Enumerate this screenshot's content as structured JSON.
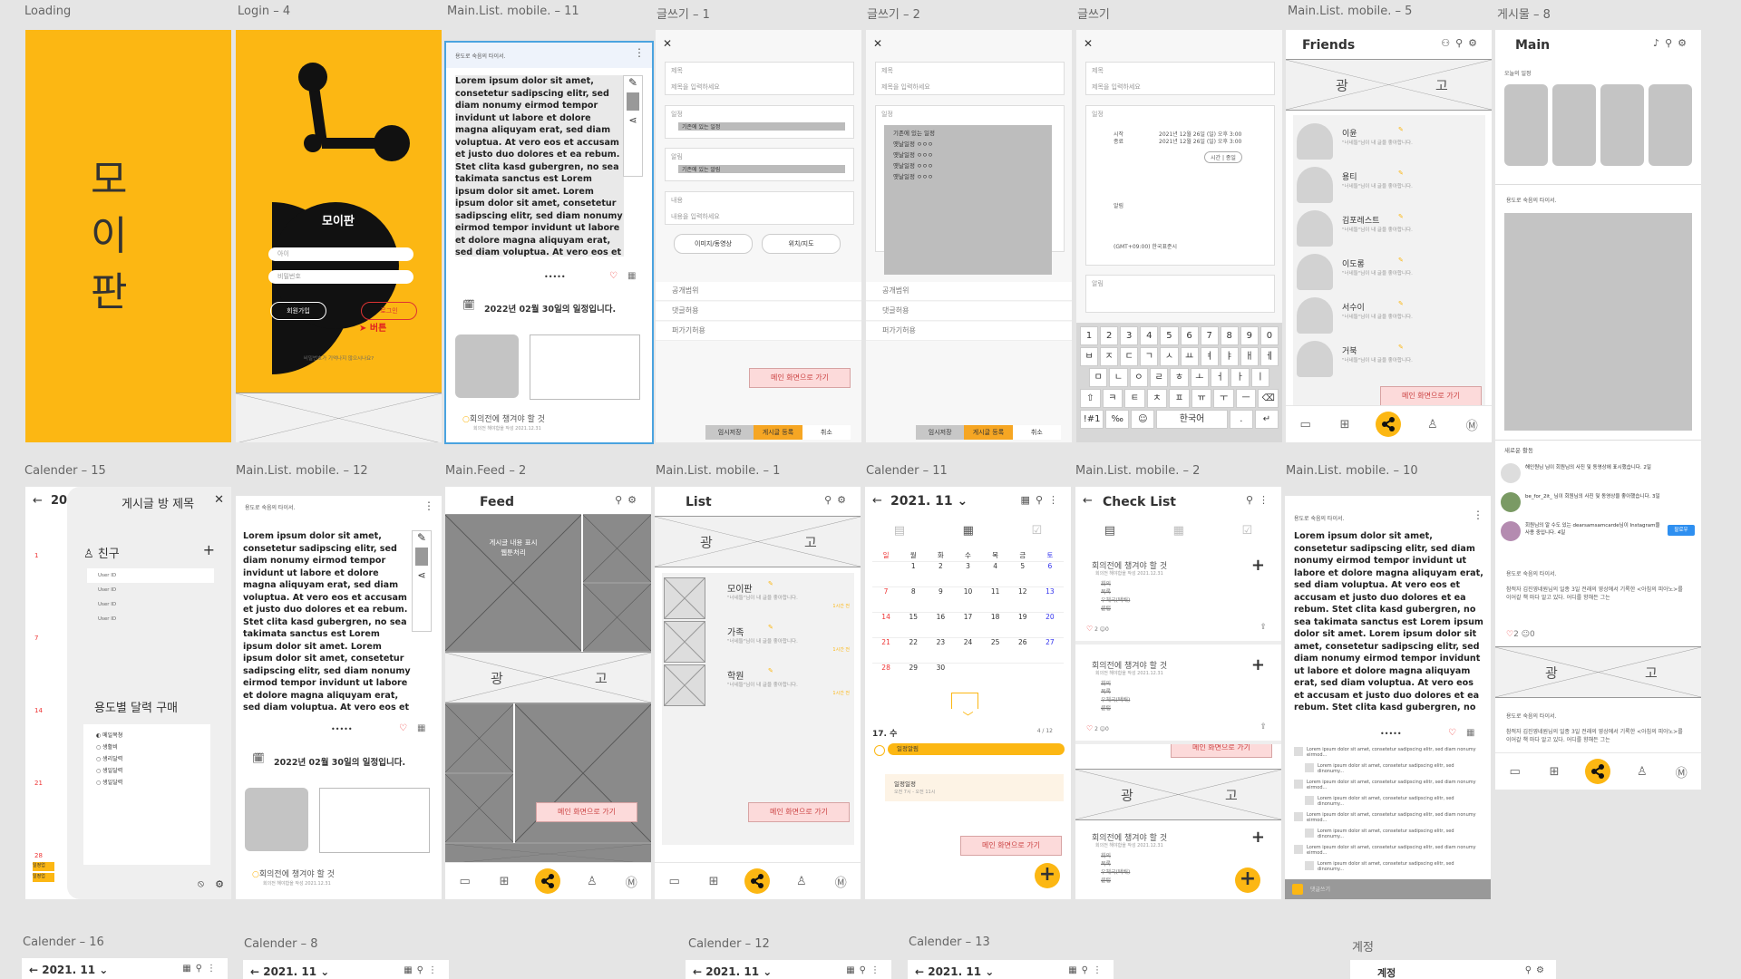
{
  "labels": {
    "loading": "Loading",
    "login4": "Login – 4",
    "mainlist11": "Main.List. mobile. – 11",
    "write1": "글쓰기 – 1",
    "write2": "글쓰기 – 2",
    "write": "글쓰기",
    "mainlist5": "Main.List. mobile. – 5",
    "post8": "게시물 – 8",
    "cal15": "Calender – 15",
    "mainlist12": "Main.List. mobile. – 12",
    "feed2": "Main.Feed – 2",
    "mainlist1": "Main.List. mobile. – 1",
    "cal11": "Calender – 11",
    "mainlist2": "Main.List. mobile. – 2",
    "mainlist10": "Main.List. mobile. – 10",
    "cal16": "Calender – 16",
    "cal8": "Calender – 8",
    "cal12": "Calender – 12",
    "cal13": "Calender – 13",
    "account": "계정"
  },
  "loading": {
    "c1": "모",
    "c2": "이",
    "c3": "판"
  },
  "login": {
    "app_name": "모이판",
    "id_placeholder": "아이",
    "pw_placeholder": "비밀번호",
    "signup": "회원가입",
    "login": "로그인",
    "button_annot": "버튼",
    "forgot": "비밀번호가 기억나지 않으시나요?"
  },
  "lorem": "Lorem ipsum dolor sit amet, consetetur sadipscing elitr, sed diam nonumy eirmod tempor invidunt ut labore et dolore magna aliquyam erat, sed diam voluptua. At vero eos et accusam et justo duo dolores et ea rebum. Stet clita kasd gubergren, no sea takimata sanctus est Lorem ipsum dolor sit amet. Lorem ipsum dolor sit amet, consetetur sadipscing elitr, sed diam nonumy eirmod tempor invidunt ut labore et dolore magna aliquyam erat, sed diam voluptua. At vero eos et accusam et justo duo dolores et ea rebum. Stet clita kasd gubergren, no sea takimata sanctus est Lorem ipsum dolor sit amet. Lorem ipsum dolor sit amet, consetetur",
  "post": {
    "header": "용도로 숙음의 타이서.",
    "schedule": "2022년 02월 30일의 일정입니다.",
    "todo": "회의전에 챙겨야 할 것",
    "todo_sub": "회의전 해야합을 작성 2021.12.31"
  },
  "write": {
    "title": "제목",
    "title_ph": "제목을 입력하세요",
    "schedule": "일정",
    "schedule_opt": "기존에 있는 일정",
    "alarm": "알림",
    "alarm_opt": "기존에 있는 알림",
    "content": "내용",
    "content_ph": "내용을 입력하세요",
    "image_btn": "이미지/동영상",
    "map_btn": "위치/지도",
    "public": "공개범위",
    "comment": "댓글허용",
    "share": "퍼가기허용",
    "go_main": "메인 화면으로 가기",
    "draft": "임시저장",
    "post": "게시글 등록",
    "cancel": "취소",
    "dropdown": [
      "기존에 있는 일정",
      "옛날일정 ㅇㅇㅇ",
      "옛날일정 ㅇㅇㅇ",
      "옛날일정 ㅇㅇㅇ",
      "옛날일정 ㅇㅇㅇ"
    ],
    "start": "시작",
    "end": "종료",
    "start_val": "2021년 12월 26일 (일) 오후 3:00",
    "end_val": "2021년 12월 26일 (일) 오후 3:00",
    "time_btn": "시간 | 종일",
    "tz": "(GMT+09:00) 한국표준시"
  },
  "keyboard": {
    "nums": [
      "1",
      "2",
      "3",
      "4",
      "5",
      "6",
      "7",
      "8",
      "9",
      "0"
    ],
    "r1": [
      "ㅂ",
      "ㅈ",
      "ㄷ",
      "ㄱ",
      "ㅅ",
      "ㅛ",
      "ㅕ",
      "ㅑ",
      "ㅐ",
      "ㅔ"
    ],
    "r2": [
      "ㅁ",
      "ㄴ",
      "ㅇ",
      "ㄹ",
      "ㅎ",
      "ㅗ",
      "ㅓ",
      "ㅏ",
      "ㅣ"
    ],
    "r3": [
      "⇧",
      "ㅋ",
      "ㅌ",
      "ㅊ",
      "ㅍ",
      "ㅠ",
      "ㅜ",
      "ㅡ",
      "⌫"
    ],
    "r4": [
      "!#1",
      "‰",
      "☺",
      "한국어",
      ".",
      "↵"
    ]
  },
  "friends": {
    "title": "Friends",
    "ad_left": "광",
    "ad_right": "고",
    "names": [
      "이윤",
      "용티",
      "김포레스트",
      "이도롱",
      "서수이",
      "거북"
    ],
    "status": "\"너네들\"님이 내 글을 좋아합니다.",
    "go_main": "메인 화면으로 가기"
  },
  "main8": {
    "title": "Main",
    "today": "오늘의 일정",
    "recent": "새로운 활동",
    "act1": "해인원님 님이 회원님의 사진 및 동영상에 표시했습니다. 2일",
    "act2": "be_for_2it_ 님이 회원님의 사진 및 동영상을 좋아했습니다. 3일",
    "act3": "회원님의 알 수도 있는 dearsamsamcarde님이 Instagram을 사용 중입니다. 4일",
    "follow": "팔로우",
    "caption": "참적자 김진영네원님의 일종 3일 전래의 영상에서 기록한 <아침의 피아노>를 이어갈 책 마다 알고 있다. 어디를 향해든 그는"
  },
  "cal15": {
    "year": "20",
    "panel_title": "게시글 방 제목",
    "friends": "친구",
    "users": [
      "User ID",
      "User ID",
      "User ID",
      "User ID"
    ],
    "buy": "용도별 달력 구매",
    "items": [
      "메일목쳥",
      "생활비",
      "생리달력",
      "생일달력",
      "생일달력"
    ],
    "day_a": "1",
    "day_b": "7",
    "day_c": "14",
    "day_d": "21",
    "day_e": "28",
    "tag1": "일정업",
    "tag2": "일정업"
  },
  "feed": {
    "title": "Feed",
    "overlay": "게시글 내용 표시\n웹툰처리",
    "ad_left": "광",
    "ad_right": "고",
    "go_main": "메인 화면으로 가기"
  },
  "list": {
    "title": "List",
    "ad_left": "광",
    "ad_right": "고",
    "items": [
      "모이판",
      "가족",
      "학원"
    ],
    "status": "\"너네들\"님이 내 글을 좋아합니다.",
    "time": "1시간 전",
    "go_main": "메인 화면으로 가기"
  },
  "cal11": {
    "month": "2021. 11",
    "weekdays": [
      "일",
      "월",
      "화",
      "수",
      "목",
      "금",
      "토"
    ],
    "days": [
      "",
      "1",
      "2",
      "3",
      "4",
      "5",
      "6",
      "7",
      "8",
      "9",
      "10",
      "11",
      "12",
      "13",
      "14",
      "15",
      "16",
      "17",
      "18",
      "19",
      "20",
      "21",
      "22",
      "23",
      "24",
      "25",
      "26",
      "27",
      "28",
      "29",
      "30",
      "",
      "",
      "",
      ""
    ],
    "sel_date": "17. 수",
    "count": "4 / 12",
    "event": "일정알림",
    "event2": "일정일정",
    "event2_sub": "오전 7시 - 오전 11시",
    "go_main": "메인 화면으로 가기"
  },
  "checklist": {
    "title": "Check List",
    "card_title": "회의전에 챙겨야 할 것",
    "card_sub": "회의전 해야합을 작성 2021.12.31",
    "items": [
      "회의",
      "목록",
      "우체국(택배)",
      "클럽"
    ],
    "likes": "2",
    "comments": "0",
    "ad_left": "광",
    "ad_right": "고",
    "go_main": "메인 화면으로 가기"
  },
  "ml10": {
    "header": "용도로 숙음의 타이서.",
    "comment_line1": "Lorem ipsum dolor sit amet, consetetur sadipscing elitr, sed diam nonumy eirmod...",
    "comment_line2": "Lorem ipsum dolor sit amet, consetetur sadipscing elitr, sed dinonumy...",
    "input_ph": "댓글쓰기"
  },
  "bottom": {
    "month": "2021. 11",
    "account": "계정"
  }
}
